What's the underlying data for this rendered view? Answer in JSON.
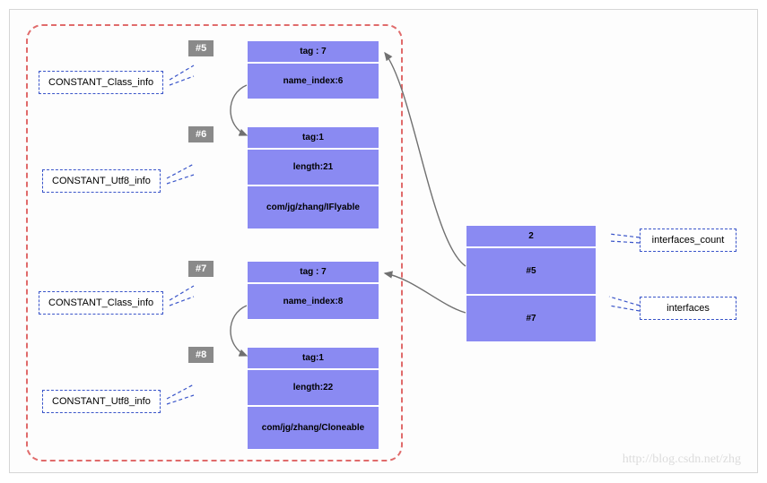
{
  "badges": {
    "b5": "#5",
    "b6": "#6",
    "b7": "#7",
    "b8": "#8"
  },
  "labels": {
    "class_info_1": "CONSTANT_Class_info",
    "utf8_info_1": "CONSTANT_Utf8_info",
    "class_info_2": "CONSTANT_Class_info",
    "utf8_info_2": "CONSTANT_Utf8_info",
    "interfaces_count": "interfaces_count",
    "interfaces": "interfaces"
  },
  "struct5": {
    "tag": "tag : 7",
    "name_index": "name_index:6"
  },
  "struct6": {
    "tag": "tag:1",
    "length": "length:21",
    "bytes": "com/jg/zhang/IFlyable"
  },
  "struct7": {
    "tag": "tag : 7",
    "name_index": "name_index:8"
  },
  "struct8": {
    "tag": "tag:1",
    "length": "length:22",
    "bytes": "com/jg/zhang/Cloneable"
  },
  "right": {
    "count": "2",
    "idx1": "#5",
    "idx2": "#7"
  },
  "watermark": "http://blog.csdn.net/zhg"
}
